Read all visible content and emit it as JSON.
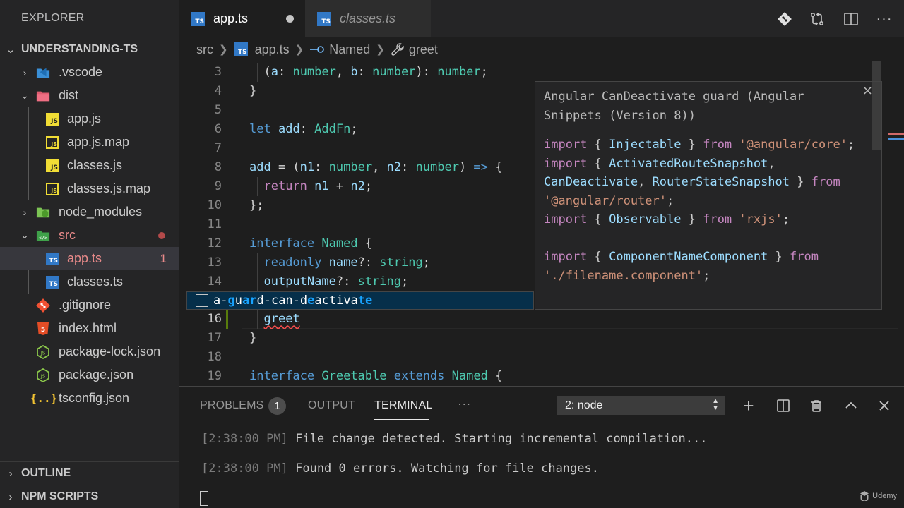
{
  "sidebar": {
    "title": "EXPLORER",
    "project": "UNDERSTANDING-TS",
    "items": [
      {
        "label": ".vscode"
      },
      {
        "label": "dist"
      },
      {
        "label": "app.js"
      },
      {
        "label": "app.js.map"
      },
      {
        "label": "classes.js"
      },
      {
        "label": "classes.js.map"
      },
      {
        "label": "node_modules"
      },
      {
        "label": "src"
      },
      {
        "label": "app.ts",
        "badge": "1"
      },
      {
        "label": "classes.ts"
      },
      {
        "label": ".gitignore"
      },
      {
        "label": "index.html"
      },
      {
        "label": "package-lock.json"
      },
      {
        "label": "package.json"
      },
      {
        "label": "tsconfig.json"
      }
    ],
    "outline": "OUTLINE",
    "npm_scripts": "NPM SCRIPTS"
  },
  "tabs": [
    {
      "label": "app.ts",
      "icon": "TS"
    },
    {
      "label": "classes.ts",
      "icon": "TS"
    }
  ],
  "breadcrumb": {
    "folder": "src",
    "file": "app.ts",
    "interface": "Named",
    "member": "greet"
  },
  "editor": {
    "line_numbers": [
      "3",
      "4",
      "5",
      "6",
      "7",
      "8",
      "9",
      "10",
      "11",
      "12",
      "13",
      "14",
      "16",
      "17",
      "18",
      "19"
    ],
    "suggestion": {
      "pre": "a-",
      "m1": "g",
      "p2": "u",
      "m2": "a",
      "p3": "",
      "m3": "r",
      "p4": "d-can-d",
      "m4": "e",
      "p5": "activa",
      "m5": "te"
    },
    "docs": {
      "title": "Angular CanDeactivate guard (Angular Snippets (Version 8))",
      "close": "×"
    }
  },
  "panel": {
    "tabs": {
      "problems": "PROBLEMS",
      "output": "OUTPUT",
      "terminal": "TERMINAL",
      "more": "···"
    },
    "problems_count": "1",
    "terminal_select": "2: node",
    "lines": [
      {
        "time": "2:38:00 PM",
        "text": "File change detected. Starting incremental compilation..."
      },
      {
        "time": "2:38:00 PM",
        "text": "Found 0 errors. Watching for file changes."
      }
    ]
  },
  "watermark": "Udemy",
  "colors": {
    "accent_ts": "#3178c6",
    "accent_js": "#f1dd35",
    "suggest_bg": "#062f4a",
    "error": "#f14c4c"
  }
}
